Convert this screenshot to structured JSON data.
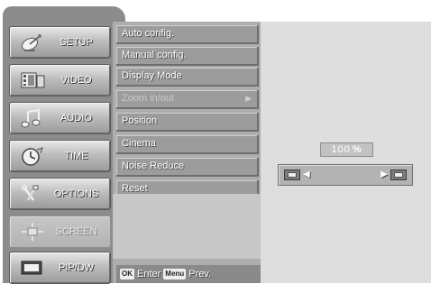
{
  "tabs": [
    {
      "label": "SETUP",
      "icon": "satellite-dish-icon"
    },
    {
      "label": "VIDEO",
      "icon": "film-icon"
    },
    {
      "label": "AUDIO",
      "icon": "music-note-icon"
    },
    {
      "label": "TIME",
      "icon": "clock-icon"
    },
    {
      "label": "OPTIONS",
      "icon": "tools-icon"
    },
    {
      "label": "SCREEN",
      "icon": "screen-adjust-icon",
      "active": true
    },
    {
      "label": "PIP/DW",
      "icon": "pip-icon"
    }
  ],
  "menu": {
    "items": [
      {
        "label": "Auto config."
      },
      {
        "label": "Manual config."
      },
      {
        "label": "Display Mode"
      },
      {
        "label": "Zoom in/out",
        "disabled": true
      },
      {
        "label": "Position"
      },
      {
        "label": "Cinema"
      },
      {
        "label": "Noise Reduce"
      },
      {
        "label": "Reset"
      }
    ]
  },
  "footer": {
    "ok_key": "OK",
    "ok_label": "Enter",
    "menu_key": "Menu",
    "menu_label": "Prev."
  },
  "zoom": {
    "value": "100",
    "unit": "%",
    "level_percent": 100
  },
  "colors": {
    "panel_gray": "#8c8c8c",
    "menu_gray": "#9c9c9c",
    "right_panel": "#dedede"
  }
}
